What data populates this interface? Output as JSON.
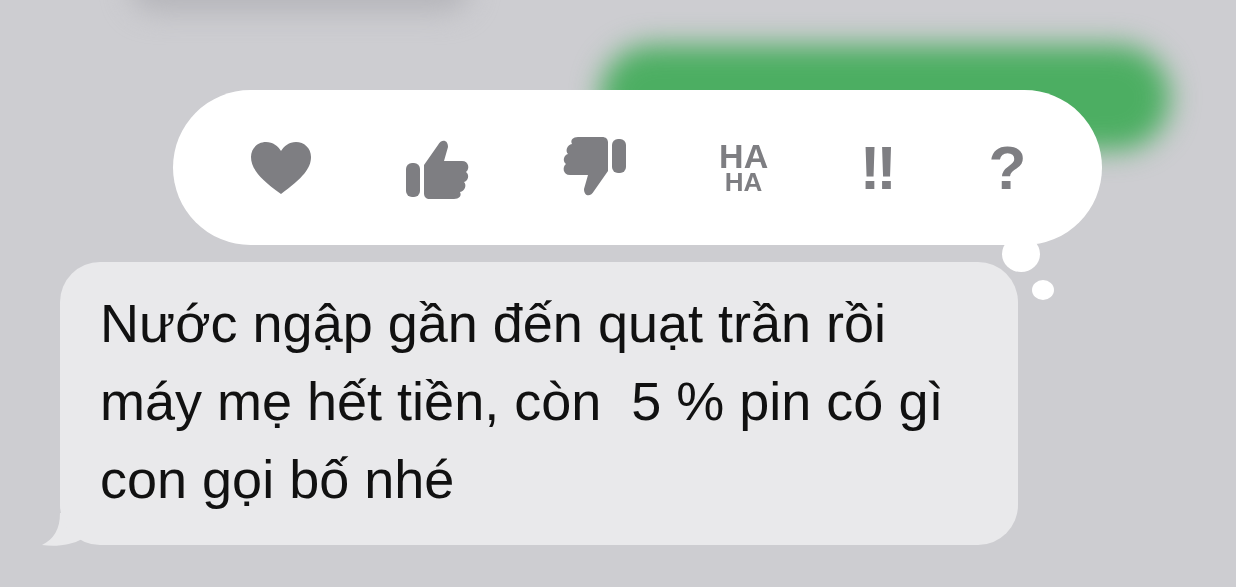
{
  "reactions": [
    {
      "kind": "heart",
      "selected": false
    },
    {
      "kind": "thumbs-up",
      "selected": false
    },
    {
      "kind": "thumbs-down",
      "selected": false
    },
    {
      "kind": "haha",
      "selected": false,
      "text": [
        "HA",
        "HA"
      ]
    },
    {
      "kind": "exclaim",
      "selected": false,
      "text": [
        "!!"
      ]
    },
    {
      "kind": "question",
      "selected": false,
      "text": [
        "?"
      ]
    }
  ],
  "message": {
    "text": "Nước ngập gần đến quạt trần rồi\nmáy mẹ hết tiền, còn  5 % pin có gì\ncon gọi bố nhé"
  }
}
